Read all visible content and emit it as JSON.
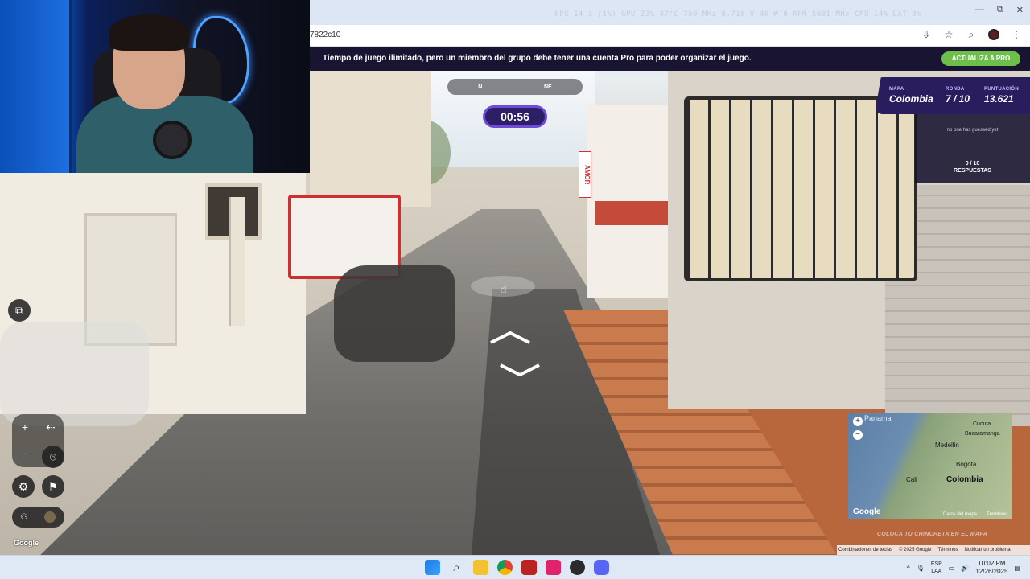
{
  "browser": {
    "url_fragment": "7822c10",
    "stats_overlay": "FPS 14  3 (1%)   GPU 23% 47°C 750 MHz 0.718 V 46 W 0 RPM 5001 MHz   CPU 14%   LAT 8%",
    "window_controls": {
      "minimize": "—",
      "restore": "⧉",
      "close": "✕"
    }
  },
  "promo": {
    "text": "Tiempo de juego ilimitado, pero un miembro del grupo debe tener una cuenta Pro para poder organizar el juego.",
    "button_label": "ACTUALIZA A PRO",
    "accent_color": "#6cc04a"
  },
  "compass": {
    "labels": [
      "N",
      "NE"
    ]
  },
  "timer": {
    "value": "00:56"
  },
  "game_info": {
    "map_label": "MAPA",
    "map_value": "Colombia",
    "round_label": "RONDA",
    "round_value": "7 / 10",
    "score_label": "PUNTUACIÓN",
    "score_value": "13.621"
  },
  "guesses": {
    "status": "no one has guessed yet",
    "count": "0 / 10",
    "answers_label": "RESPUESTAS"
  },
  "scene_sign": "AMOR",
  "controls": {
    "zoom_in": "+",
    "zoom_out": "−",
    "back_icon": "arrow-back",
    "pin_icon": "location-pin",
    "settings_icon": "gear",
    "flag_icon": "flag",
    "google_watermark": "Google"
  },
  "minimap": {
    "places": [
      "Panama",
      "Cucuta",
      "Bucaramanga",
      "Medellin",
      "Bogota",
      "Cali",
      "Colombia"
    ],
    "google": "Google",
    "attribution": "Datos del mapa",
    "terms": "Términos",
    "zoom_in": "+",
    "zoom_out": "−",
    "hint": "COLOCA TU CHINCHETA EN EL MAPA"
  },
  "gmaps_bar": {
    "shortcuts": "Combinaciones de teclas",
    "copyright": "© 2025 Google",
    "terms": "Términos",
    "report": "Notificar un problema"
  },
  "taskbar": {
    "lang_top": "ESP",
    "lang_bottom": "LAA",
    "time": "10:02 PM",
    "date": "12/26/2025",
    "chevron": "^"
  }
}
